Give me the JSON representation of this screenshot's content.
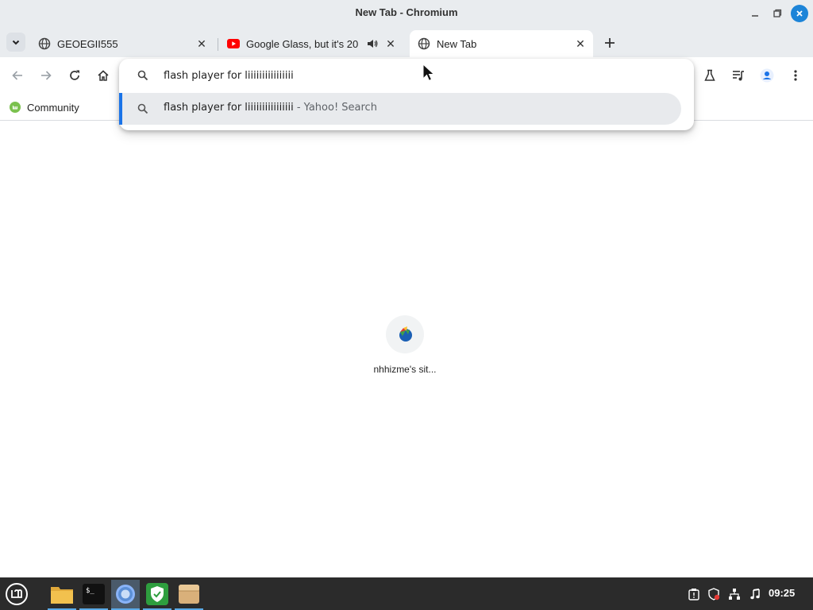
{
  "window": {
    "title": "New Tab - Chromium"
  },
  "tabs": [
    {
      "label": "GEOEGII555",
      "favicon": "globe-icon",
      "active": false
    },
    {
      "label": "Google Glass, but it's 20",
      "favicon": "youtube-icon",
      "audio": true,
      "active": false
    },
    {
      "label": "New Tab",
      "favicon": "globe-icon",
      "active": true
    }
  ],
  "omnibox": {
    "input_value": "flash player for liiiiiiiiiiiiiiii",
    "suggestion_main": "flash player for liiiiiiiiiiiiiiii",
    "suggestion_suffix": " - Yahoo! Search"
  },
  "bookmarks": [
    {
      "label": "Community",
      "icon": "linux-mint-icon"
    }
  ],
  "shortcuts": [
    {
      "label": "nhhizme's sit..."
    }
  ],
  "taskbar": {
    "clock": "09:25",
    "apps": [
      "menu-icon",
      "files-icon",
      "terminal-icon",
      "chromium-icon",
      "shield-icon",
      "archive-icon"
    ]
  },
  "colors": {
    "accent": "#1a73e8",
    "taskbar_bg": "#2b2b2b",
    "chrome_bg": "#e9ecef"
  }
}
